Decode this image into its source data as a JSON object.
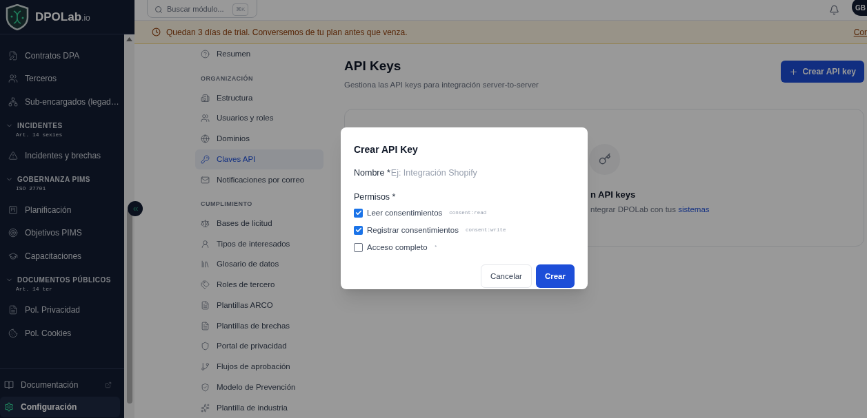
{
  "brand": {
    "name": "DPOLab",
    "suffix": ".io"
  },
  "sidebar": {
    "items": [
      {
        "kind": "item",
        "label": "Contratos DPA",
        "selected": false
      },
      {
        "kind": "item",
        "label": "Terceros",
        "selected": false
      },
      {
        "kind": "item",
        "label": "Sub-encargados (legad…",
        "selected": false
      },
      {
        "kind": "section",
        "label": "INCIDENTES",
        "sub": "Art. 14 sexies",
        "expanded": true
      },
      {
        "kind": "item",
        "label": "Incidentes y brechas",
        "selected": false
      },
      {
        "kind": "section",
        "label": "GOBERNANZA PIMS",
        "sub": "ISO 27701",
        "expanded": true
      },
      {
        "kind": "item",
        "label": "Planificación",
        "selected": false
      },
      {
        "kind": "item",
        "label": "Objetivos PIMS",
        "selected": false
      },
      {
        "kind": "item",
        "label": "Capacitaciones",
        "selected": false
      },
      {
        "kind": "section",
        "label": "DOCUMENTOS PÚBLICOS",
        "sub": "Art. 14 ter",
        "expanded": true
      },
      {
        "kind": "item",
        "label": "Pol. Privacidad",
        "selected": false
      },
      {
        "kind": "item",
        "label": "Pol. Cookies",
        "selected": false
      }
    ],
    "footer": [
      {
        "label": "Documentación",
        "external": true,
        "selected": false
      },
      {
        "label": "Configuración",
        "external": false,
        "selected": true
      }
    ]
  },
  "topbar": {
    "search": {
      "placeholder": "Buscar módulo...",
      "shortcut": "⌘K"
    },
    "avatar": "GB"
  },
  "banner": {
    "text": "Quedan 3 días de trial. Conversemos de tu plan antes que venza.",
    "link": "Cor"
  },
  "settings_nav": [
    {
      "kind": "item",
      "label": "Resumen",
      "selected": false
    },
    {
      "kind": "section",
      "label": "ORGANIZACIÓN"
    },
    {
      "kind": "item",
      "label": "Estructura",
      "selected": false
    },
    {
      "kind": "item",
      "label": "Usuarios y roles",
      "selected": false
    },
    {
      "kind": "item",
      "label": "Dominios",
      "selected": false
    },
    {
      "kind": "item",
      "label": "Claves API",
      "selected": true
    },
    {
      "kind": "item",
      "label": "Notificaciones por correo",
      "selected": false
    },
    {
      "kind": "section",
      "label": "CUMPLIMIENTO"
    },
    {
      "kind": "item",
      "label": "Bases de licitud",
      "selected": false
    },
    {
      "kind": "item",
      "label": "Tipos de interesados",
      "selected": false
    },
    {
      "kind": "item",
      "label": "Glosario de datos",
      "selected": false
    },
    {
      "kind": "item",
      "label": "Roles de tercero",
      "selected": false
    },
    {
      "kind": "item",
      "label": "Plantillas ARCO",
      "selected": false
    },
    {
      "kind": "item",
      "label": "Plantillas de brechas",
      "selected": false
    },
    {
      "kind": "item",
      "label": "Portal de privacidad",
      "selected": false
    },
    {
      "kind": "item",
      "label": "Flujos de aprobación",
      "selected": false
    },
    {
      "kind": "item",
      "label": "Modelo de Prevención",
      "selected": false
    },
    {
      "kind": "item",
      "label": "Plantilla de industria",
      "selected": false
    }
  ],
  "page": {
    "title": "API Keys",
    "subtitle": "Gestiona las API keys para integración server-to-server",
    "create_button": "Crear API key",
    "empty_state": {
      "title": "n API keys",
      "text": "ntegrar DPOLab con tus",
      "link": "sistemas"
    }
  },
  "dialog": {
    "title": "Crear API Key",
    "name_label": "Nombre *",
    "name_placeholder": "Ej: Integración Shopify",
    "permissions_label": "Permisos *",
    "permissions": [
      {
        "label": "Leer consentimientos",
        "scope": "consent:read",
        "checked": true
      },
      {
        "label": "Registrar consentimientos",
        "scope": "consent:write",
        "checked": true
      },
      {
        "label": "Acceso completo",
        "scope": "*",
        "checked": false
      }
    ],
    "buttons": [
      {
        "kind": "secondary",
        "label": "Cancelar"
      },
      {
        "kind": "primary",
        "label": "Crear"
      }
    ]
  }
}
